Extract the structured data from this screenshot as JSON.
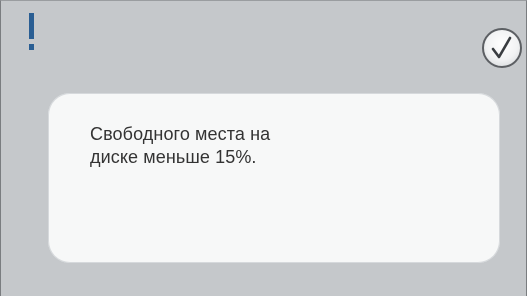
{
  "dialog": {
    "alert_icon": "exclamation-icon",
    "ok_icon": "checkmark-icon",
    "message_lines": [
      "Свободного места на",
      "диске меньше 15%."
    ],
    "colors": {
      "panel_background": "#c5c8cb",
      "card_background": "#f7f8f8",
      "accent": "#2a5e93",
      "text": "#333333"
    }
  }
}
